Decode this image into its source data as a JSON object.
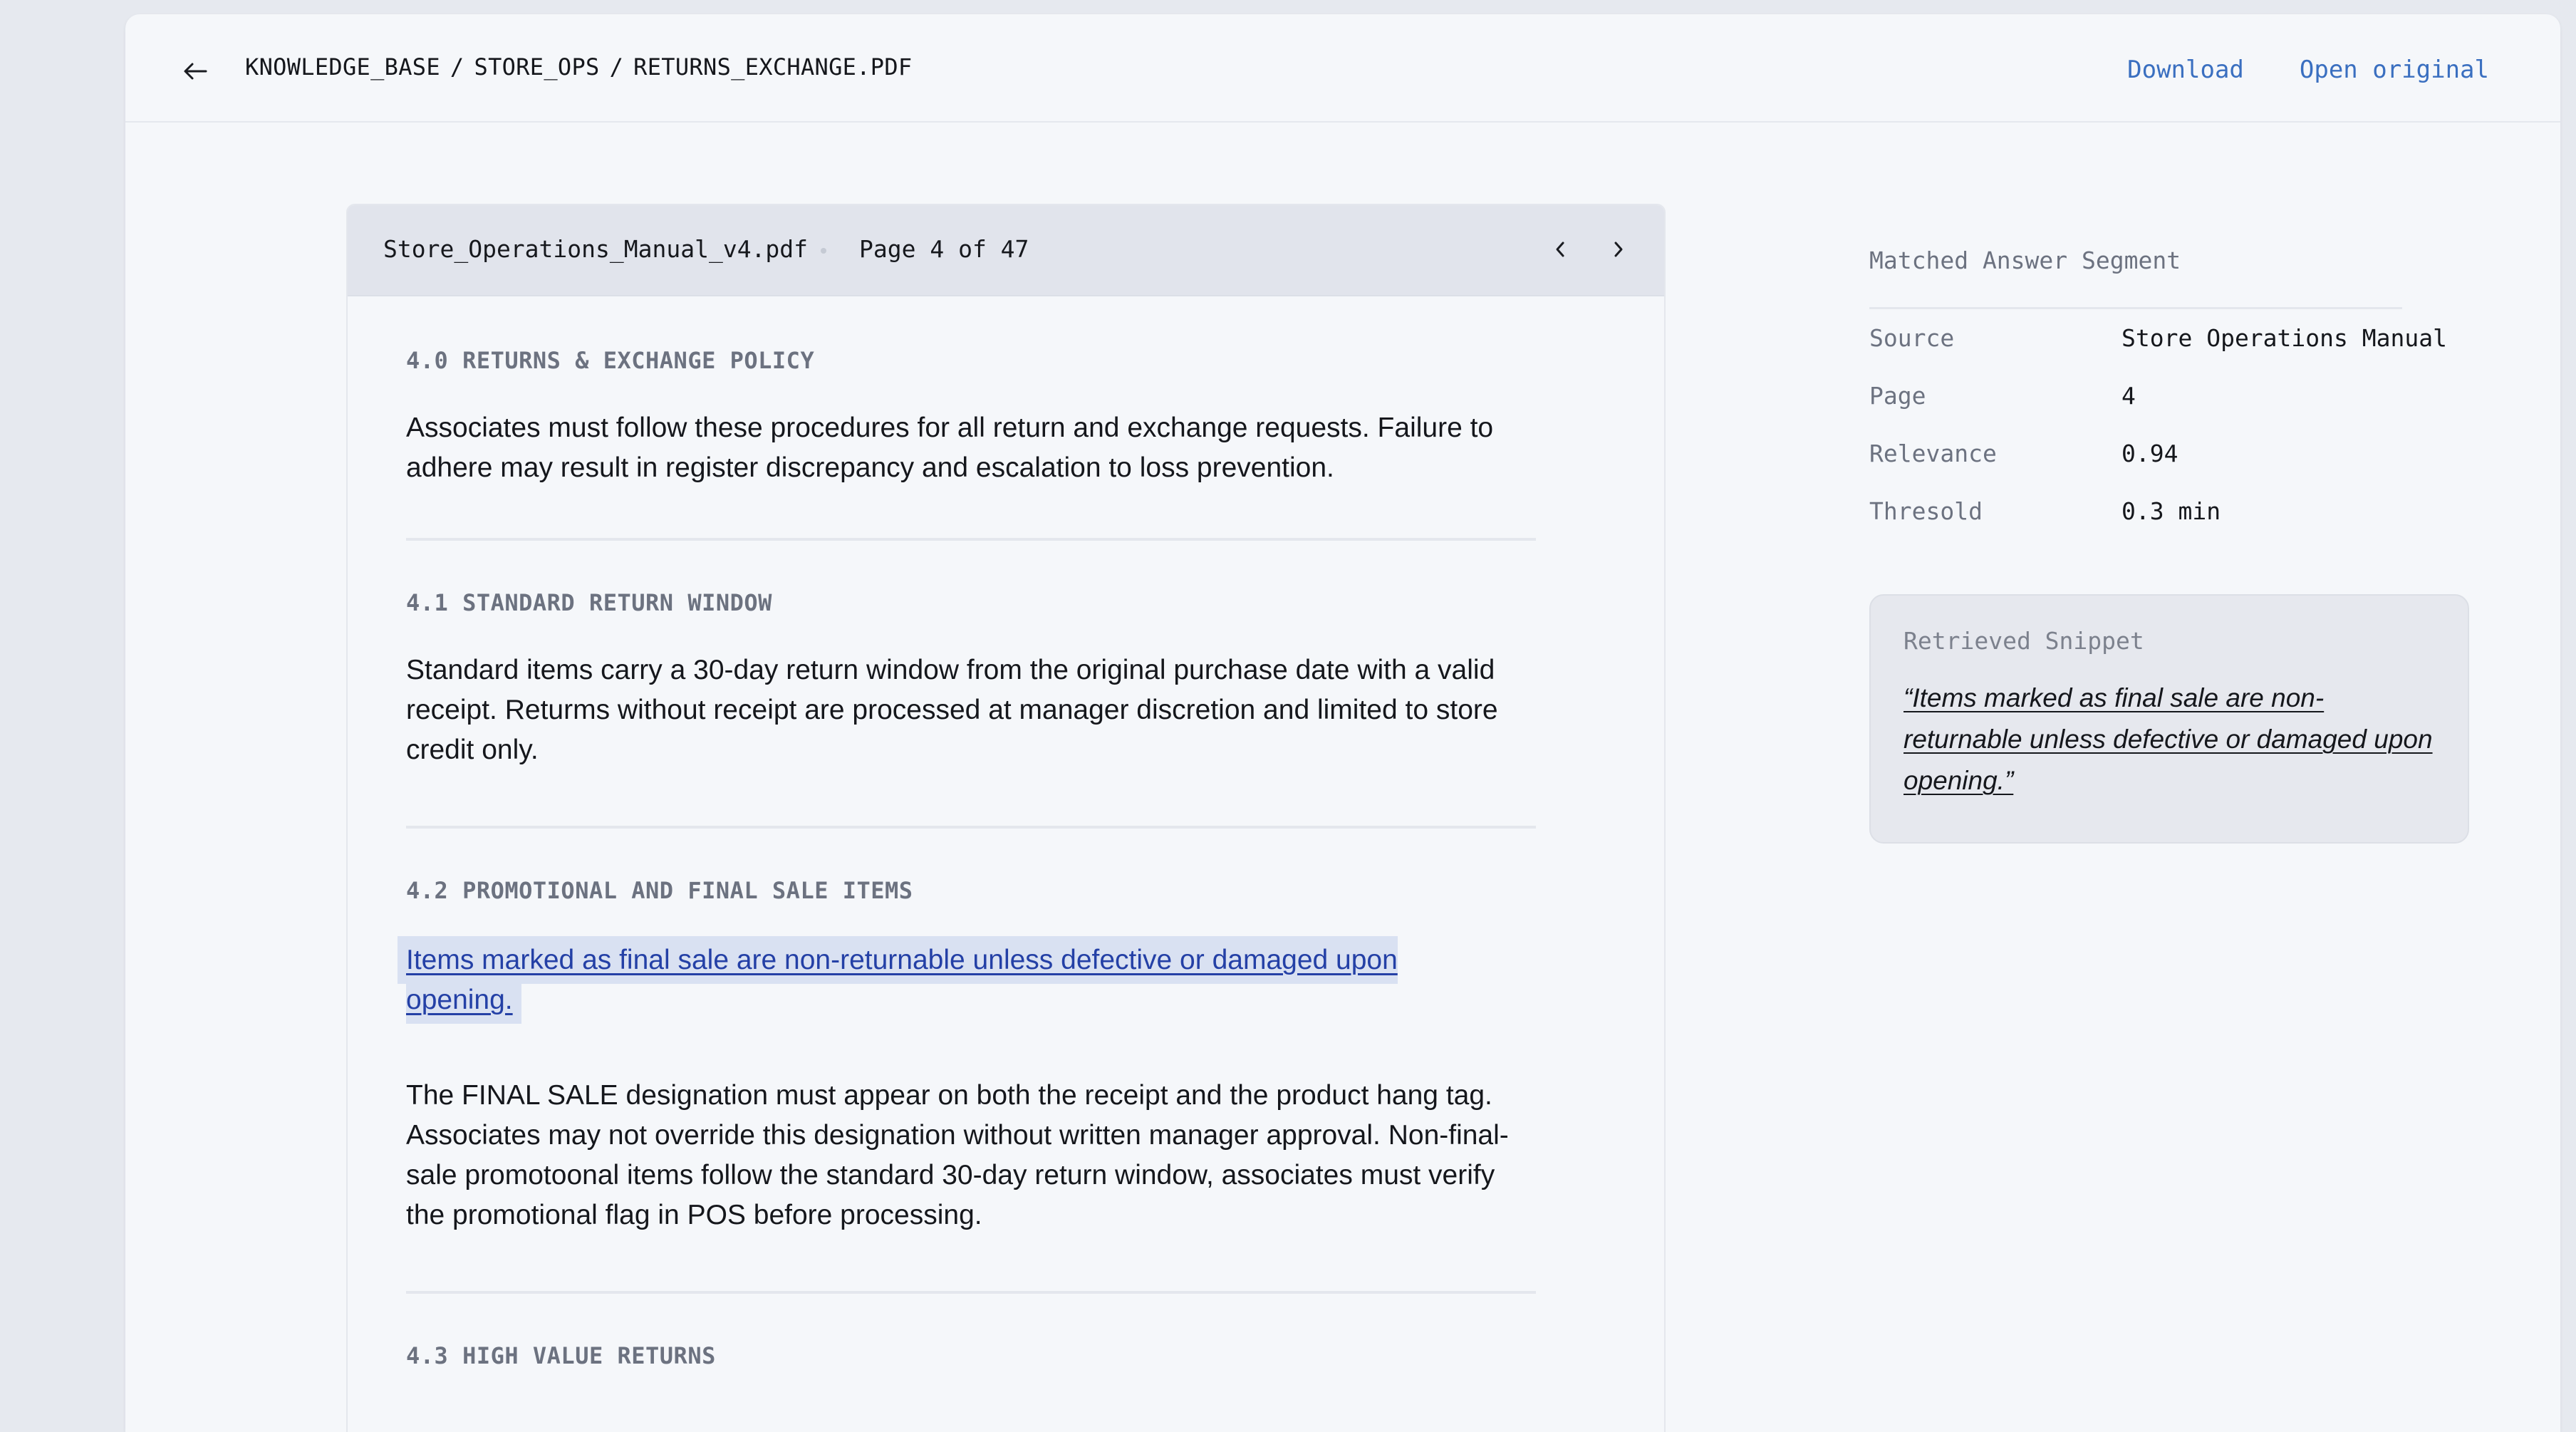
{
  "header": {
    "breadcrumb": [
      "KNOWLEDGE_BASE",
      "STORE_OPS",
      "RETURNS_EXCHANGE.PDF"
    ],
    "breadcrumb_separator": "/",
    "download_label": "Download",
    "open_original_label": "Open original",
    "back_icon": "arrow-left-icon"
  },
  "document": {
    "filename": "Store_Operations_Manual_v4.pdf",
    "page_label": "Page 4 of 47",
    "prev_icon": "chevron-left-icon",
    "next_icon": "chevron-right-icon",
    "sections": [
      {
        "heading": "4.0 RETURNS & EXCHANGE POLICY",
        "paragraph": "Associates must follow these procedures for all return and exchange requests. Failure to adhere may result in register discrepancy and escalation to loss prevention."
      },
      {
        "heading": "4.1 STANDARD RETURN WINDOW",
        "paragraph": "Standard items carry a 30-day return window from the original purchase date with a valid receipt. Returms without receipt are processed at manager discretion and limited to store credit only."
      },
      {
        "heading": "4.2 PROMOTIONAL AND FINAL SALE ITEMS",
        "highlighted": "Items marked as final sale are non-returnable unless defective or damaged upon opening.",
        "paragraph": "The FINAL SALE designation must appear on both the receipt and the product hang tag. Associates may not override this designation without written manager approval. Non-final-sale promotoonal items follow the standard 30-day return window, associates must verify the promotional flag in POS before processing."
      },
      {
        "heading": "4.3 HIGH VALUE RETURNS"
      }
    ]
  },
  "sidebar": {
    "title": "Matched Answer Segment",
    "meta": [
      {
        "label": "Source",
        "value": "Store Operations Manual"
      },
      {
        "label": "Page",
        "value": "4"
      },
      {
        "label": "Relevance",
        "value": "0.94"
      },
      {
        "label": "Thresold",
        "value": "0.3 min"
      }
    ],
    "snippet_label": "Retrieved Snippet",
    "snippet_text": "“Items marked as final sale are non-returnable unless defective or damaged upon opening.”"
  },
  "colors": {
    "accent": "#3a6fc0",
    "highlight_bg": "#d9e1f2",
    "highlight_text": "#2440a6"
  }
}
